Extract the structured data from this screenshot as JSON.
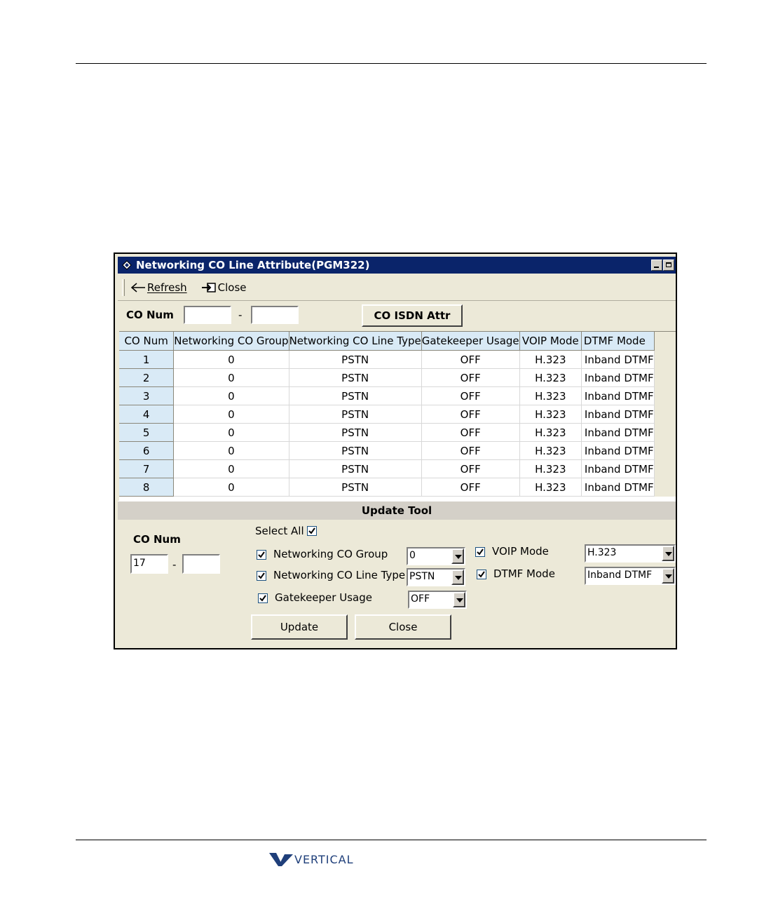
{
  "window": {
    "title": "Networking CO Line Attribute(PGM322)"
  },
  "toolbar": {
    "refresh_label": "Refresh",
    "close_label": "Close"
  },
  "filter": {
    "co_num_label": "CO Num",
    "from_value": "",
    "dash": "-",
    "to_value": "",
    "isdn_button": "CO ISDN Attr"
  },
  "grid": {
    "columns": [
      "CO Num",
      "Networking CO Group",
      "Networking CO Line Type",
      "Gatekeeper Usage",
      "VOIP Mode",
      "DTMF Mode"
    ],
    "rows": [
      [
        "1",
        "0",
        "PSTN",
        "OFF",
        "H.323",
        "Inband DTMF"
      ],
      [
        "2",
        "0",
        "PSTN",
        "OFF",
        "H.323",
        "Inband DTMF"
      ],
      [
        "3",
        "0",
        "PSTN",
        "OFF",
        "H.323",
        "Inband DTMF"
      ],
      [
        "4",
        "0",
        "PSTN",
        "OFF",
        "H.323",
        "Inband DTMF"
      ],
      [
        "5",
        "0",
        "PSTN",
        "OFF",
        "H.323",
        "Inband DTMF"
      ],
      [
        "6",
        "0",
        "PSTN",
        "OFF",
        "H.323",
        "Inband DTMF"
      ],
      [
        "7",
        "0",
        "PSTN",
        "OFF",
        "H.323",
        "Inband DTMF"
      ],
      [
        "8",
        "0",
        "PSTN",
        "OFF",
        "H.323",
        "Inband DTMF"
      ]
    ]
  },
  "update_tool": {
    "header": "Update Tool",
    "co_num_label": "CO Num",
    "from_value": "17",
    "dash": "-",
    "to_value": "",
    "select_all_label": "Select All",
    "networking_co_group_label": "Networking CO Group",
    "networking_co_group_value": "0",
    "networking_co_line_type_label": "Networking CO Line Type",
    "networking_co_line_type_value": "PSTN",
    "gatekeeper_usage_label": "Gatekeeper Usage",
    "gatekeeper_usage_value": "OFF",
    "voip_mode_label": "VOIP Mode",
    "voip_mode_value": "H.323",
    "dtmf_mode_label": "DTMF Mode",
    "dtmf_mode_value": "Inband DTMF",
    "update_button": "Update",
    "close_button": "Close"
  },
  "footer": {
    "logo_text": "VERTICAL",
    "logo_color": "#1f3f7a"
  },
  "colors": {
    "title_bar": "#0a246a",
    "grid_header": "#d9eaf6",
    "window_face": "#ece9d8"
  }
}
